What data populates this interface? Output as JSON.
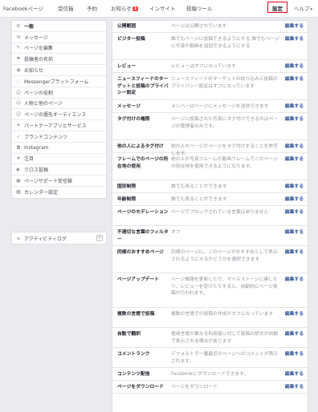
{
  "topnav": {
    "facebook_page": "Facebookページ",
    "inbox": "受信箱",
    "scheduled": "予約",
    "notifications": "お知らせ",
    "notifications_badge": "1",
    "insights": "インサイト",
    "publishing_tools": "投稿ツール",
    "settings": "設定",
    "help": "ヘルプ",
    "caret": "▾"
  },
  "sidebar": {
    "items": [
      {
        "label": "一般",
        "icon": "gear-icon",
        "glyph": "⚙"
      },
      {
        "label": "メッセージ",
        "icon": "message-icon",
        "glyph": "✉"
      },
      {
        "label": "ページを編集",
        "icon": "edit-icon",
        "glyph": "✎"
      },
      {
        "label": "投稿者の名前",
        "icon": "flag-icon",
        "glyph": "⚑"
      },
      {
        "label": "お知らせ",
        "icon": "globe-icon",
        "glyph": "◉"
      },
      {
        "label": "Messengerプラットフォーム",
        "icon": "messenger-icon",
        "glyph": "◌"
      },
      {
        "label": "ページの役割",
        "icon": "person-icon",
        "glyph": "☺"
      },
      {
        "label": "人物と他のページ",
        "icon": "people-icon",
        "glyph": "☺"
      },
      {
        "label": "ページの優先オーディエンス",
        "icon": "audience-icon",
        "glyph": "☺"
      },
      {
        "label": "パートナーアプリとサービス",
        "icon": "partner-icon",
        "glyph": "✦"
      },
      {
        "label": "ブランドコンテンツ",
        "icon": "brand-icon",
        "glyph": "✓"
      },
      {
        "label": "Instagram",
        "icon": "instagram-icon",
        "glyph": "◘"
      },
      {
        "label": "注目",
        "icon": "star-icon",
        "glyph": "★"
      },
      {
        "label": "クロス投稿",
        "icon": "crosspost-icon",
        "glyph": "▶"
      },
      {
        "label": "ページサポート受信箱",
        "icon": "support-inbox-icon",
        "glyph": "▣"
      },
      {
        "label": "カレンダー設定",
        "icon": "calendar-icon",
        "glyph": "▦"
      }
    ],
    "activity_log": "アクティビティログ",
    "activity_icon_glyph": "≡",
    "activity_plus": "+"
  },
  "settings_rows": [
    {
      "label": "公開範囲",
      "value": "ページは公開されています",
      "edit": "編集する"
    },
    {
      "label": "ビジター投稿",
      "value": "誰でもページに投稿できるようにする 誰でもページに写真や動画を追加できるようにする",
      "edit": "編集する"
    },
    {
      "label": "レビュー",
      "value": "レビューはオフになっています",
      "edit": "編集する"
    },
    {
      "label": "ニュースフィードのターゲットと投稿のプライバシー設定",
      "value": "ニュースフィードのターゲットの絞り込みと投稿のプライバシー設定はオフになっています",
      "edit": "編集する"
    },
    {
      "label": "メッセージ",
      "value": "メンバーはページにメッセージを送信できます",
      "edit": "編集する"
    },
    {
      "label": "タグ付けの権限",
      "value": "ページに投稿された写真にタグ付けできるのはページの管理者のみです。",
      "edit": "編集する"
    },
    {
      "label": "他の人によるタグ付け",
      "value": "他の人やページがページをタグ付けすることを許可します。",
      "edit": "編集する"
    },
    {
      "label": "フレームでのページの所在地の使用",
      "value": "他の人が写真フレームや動画フレームでこのページの所在地を使用できるようになります。",
      "edit": "編集する"
    },
    {
      "label": "国別制限",
      "value": "誰でも見ることができます",
      "edit": "編集する"
    },
    {
      "label": "年齢制限",
      "value": "誰でも見ることができます",
      "edit": "編集する"
    },
    {
      "label": "ページのモデレーション",
      "value": "ページでブロックされている言葉はありません",
      "edit": "編集する"
    },
    {
      "label": "不適切な言葉のフィルター",
      "value": "オフ",
      "edit": "編集する"
    },
    {
      "label": "同様のおすすめページ",
      "value": "同様のページに、このページがおすすめとして表示されるようにするかどうかを選択できます",
      "edit": "編集する"
    },
    {
      "label": "ページアップデート",
      "value": "ページ情報を更新したり、マイルストーンに達したり、レビューを受けたりすると、自動的にページ投稿が行われます。",
      "edit": "編集する"
    },
    {
      "label": "複数の言語で投稿",
      "value": "複数の言語での投稿の作成がオフになっています",
      "edit": "編集する"
    },
    {
      "label": "自動で翻訳",
      "value": "使用言語が異なる利用者に対して投稿の訳文が自動で表示される場合があります",
      "edit": "編集する"
    },
    {
      "label": "コメントランク",
      "value": "デフォルトで一番最近のページへのコメントが表示されます。",
      "edit": "編集する"
    },
    {
      "label": "コンテンツ配信",
      "value": "Facebookにダウンロードできます。",
      "edit": "編集する"
    },
    {
      "label": "ページをダウンロード",
      "value": "ページをダウンロード",
      "edit": "編集する"
    }
  ]
}
